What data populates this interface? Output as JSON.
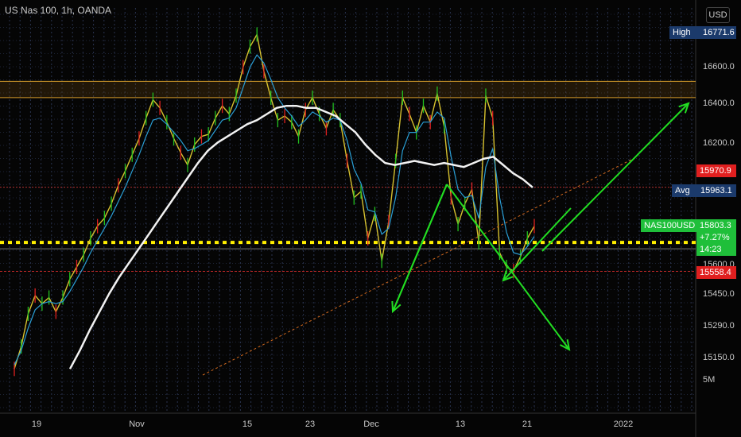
{
  "chart_data": {
    "type": "line",
    "title": "US Nas 100, 1h, OANDA",
    "currency": "USD",
    "symbol": "NAS100USD",
    "x_ticks": [
      "19",
      "Nov",
      "15",
      "23",
      "Dec",
      "13",
      "21",
      "2022"
    ],
    "y_ticks": [
      "16600.0",
      "16400.0",
      "16200.0",
      "15600.0",
      "15450.0",
      "15290.0",
      "15150.0",
      "5M"
    ],
    "ylim": [
      15050,
      16850
    ],
    "grid": true,
    "series": [
      {
        "kind": "price",
        "color": "#d6c12f",
        "values": [
          15080,
          15190,
          15350,
          15440,
          15400,
          15430,
          15360,
          15430,
          15520,
          15580,
          15640,
          15720,
          15780,
          15820,
          15890,
          15980,
          16050,
          16130,
          16210,
          16310,
          16400,
          16360,
          16290,
          16210,
          16140,
          16080,
          16180,
          16220,
          16230,
          16310,
          16370,
          16330,
          16420,
          16560,
          16660,
          16720,
          16540,
          16410,
          16300,
          16320,
          16290,
          16220,
          16350,
          16410,
          16330,
          16260,
          16350,
          16300,
          16100,
          15920,
          15950,
          15720,
          15840,
          15610,
          15800,
          16100,
          16410,
          16330,
          16240,
          16370,
          16290,
          16430,
          16270,
          15920,
          15790,
          15890,
          15960,
          15700,
          16420,
          16310,
          15650,
          15580,
          15560,
          15630,
          15720,
          15780
        ]
      },
      {
        "kind": "ema-fast",
        "color": "#2a9fd6",
        "values": [
          15100,
          15170,
          15280,
          15370,
          15400,
          15410,
          15400,
          15410,
          15460,
          15520,
          15580,
          15650,
          15710,
          15770,
          15830,
          15900,
          15970,
          16050,
          16130,
          16220,
          16300,
          16310,
          16280,
          16240,
          16200,
          16150,
          16160,
          16180,
          16200,
          16250,
          16300,
          16310,
          16360,
          16460,
          16560,
          16620,
          16580,
          16500,
          16410,
          16360,
          16320,
          16270,
          16300,
          16340,
          16320,
          16290,
          16310,
          16300,
          16200,
          16060,
          15990,
          15860,
          15850,
          15740,
          15770,
          15920,
          16150,
          16240,
          16240,
          16290,
          16290,
          16340,
          16310,
          16120,
          15960,
          15920,
          15930,
          15820,
          16070,
          16160,
          15920,
          15750,
          15650,
          15640,
          15680,
          15730
        ]
      },
      {
        "kind": "sma-slow",
        "color": "#f2f2f2",
        "values": [
          15080,
          15170,
          15270,
          15360,
          15450,
          15530,
          15600,
          15670,
          15740,
          15810,
          15880,
          15950,
          16020,
          16090,
          16150,
          16190,
          16220,
          16250,
          16280,
          16300,
          16330,
          16360,
          16370,
          16370,
          16360,
          16360,
          16340,
          16320,
          16280,
          16240,
          16180,
          16130,
          16090,
          16080,
          16090,
          16100,
          16090,
          16080,
          16090,
          16080,
          16070,
          16090,
          16110,
          16120,
          16080,
          16040,
          16010,
          15970
        ]
      }
    ],
    "series_range": {
      "price": [
        15080,
        15780
      ],
      "ema-fast": [
        15100,
        15730
      ],
      "sma-slow": [
        15080,
        15970
      ]
    },
    "levels": [
      {
        "name": "resistance-upper",
        "value": 16490,
        "color": "#d29a2a"
      },
      {
        "name": "resistance-lower",
        "value": 16410,
        "color": "#d29a2a"
      },
      {
        "name": "support-dotted",
        "value": 15700,
        "color": "#ffee00"
      },
      {
        "name": "support-red",
        "value": 15558.4,
        "color": "#c02828"
      },
      {
        "name": "level-red-dashed",
        "value": 15970.9,
        "color": "#b03030"
      }
    ],
    "tags": {
      "high": {
        "label": "High",
        "value": "16771.6"
      },
      "avg": {
        "label": "Avg",
        "value": "15963.1"
      },
      "red_top": "15970.9",
      "price": {
        "symbol": "NAS100USD",
        "value": "15803.3",
        "change": "+7.27%",
        "countdown": "14:23"
      },
      "red_bottom": "15558.4"
    },
    "drawings": {
      "arrows_color": "#22dd22",
      "trendline_color": "#d2691e"
    }
  }
}
